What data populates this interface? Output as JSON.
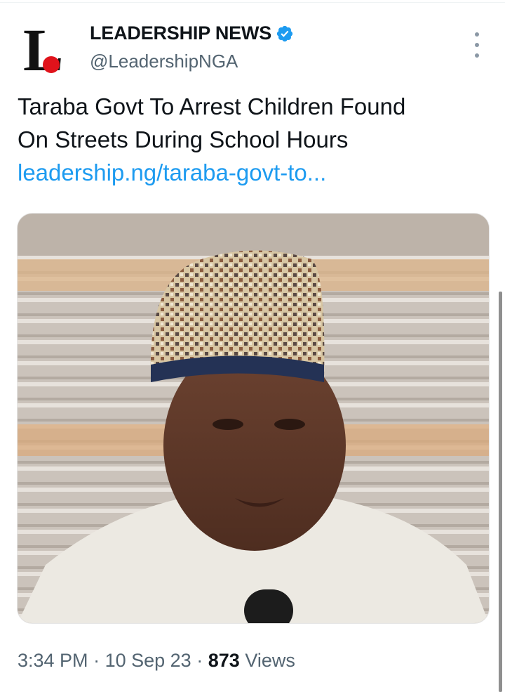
{
  "account": {
    "avatar_letter": "L",
    "display_name": "LEADERSHIP NEWS",
    "handle": "@LeadershipNGA",
    "verified_color": "#1d9bf0"
  },
  "tweet": {
    "text_line1": "Taraba Govt To Arrest Children Found",
    "text_line2": "On Streets During School Hours",
    "link": "leadership.ng/taraba-govt-to..."
  },
  "meta": {
    "time": "3:34 PM",
    "separator": "·",
    "date": "10 Sep 23",
    "views_count": "873",
    "views_label": "Views"
  },
  "colors": {
    "link": "#1d9bf0",
    "secondary_text": "#536471",
    "logo_dot": "#e0131b"
  }
}
